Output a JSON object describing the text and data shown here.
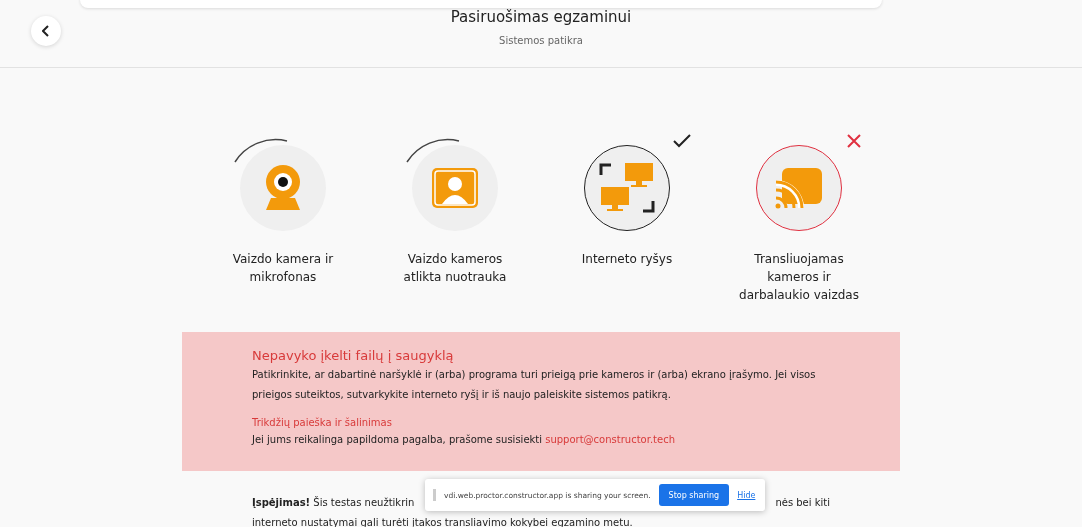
{
  "header": {
    "title": "Pasiruošimas egzaminui",
    "subtitle": "Sistemos patikra"
  },
  "steps": [
    {
      "label": "Vaizdo kamera ir mikrofonas",
      "kind": "loading"
    },
    {
      "label": "Vaizdo kameros atlikta nuotrauka",
      "kind": "loading"
    },
    {
      "label": "Interneto ryšys",
      "kind": "success"
    },
    {
      "label": "Transliuojamas kameros ir darbalaukio vaizdas",
      "kind": "error"
    }
  ],
  "alert": {
    "title": "Nepavyko įkelti failų į saugyklą",
    "body": "Patikrinkite, ar dabartinė naršyklė ir (arba) programa turi prieigą prie kameros ir (arba) ekrano įrašymo. Jei visos prieigos suteiktos, sutvarkykite interneto ryšį ir iš naujo paleiskite sistemos patikrą.",
    "link": "Trikdžių paieška ir šalinimas",
    "help": "Jei jums reikalinga papildoma pagalba, prašome susisiekti",
    "email": "support@constructor.tech"
  },
  "warning": {
    "start": "**Įspėjimas!** Šis testas neužtikrin",
    "end": "nės bei kiti",
    "line2": "interneto nustatymai gali turėti įtakos transliavimo kokybei egzamino metu."
  },
  "sharing_bar": {
    "message": "vdi.web.proctor.constructor.app is sharing your screen.",
    "stop": "Stop sharing",
    "hide": "Hide"
  }
}
